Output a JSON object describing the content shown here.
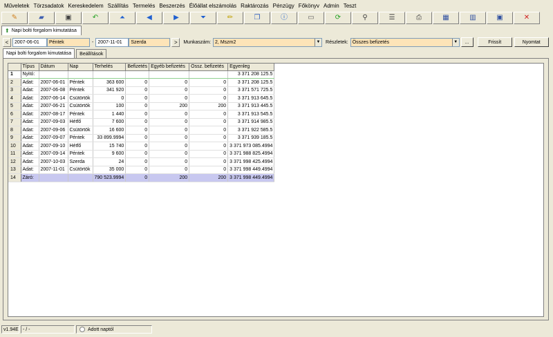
{
  "menu": [
    "Műveletek",
    "Törzsadatok",
    "Kereskedelem",
    "Szállítás",
    "Termelés",
    "Beszerzés",
    "Élőállat elszámolás",
    "Raktározás",
    "Pénzügy",
    "Főkönyv",
    "Admin",
    "Teszt"
  ],
  "toolbar": [
    {
      "name": "new-icon",
      "glyph": "✎",
      "color": "#d08020"
    },
    {
      "name": "open-folder-icon",
      "glyph": "▰",
      "color": "#4060b0"
    },
    {
      "name": "save-icon",
      "glyph": "▣",
      "color": "#404040"
    },
    {
      "name": "undo-icon",
      "glyph": "↶",
      "color": "#20a020"
    },
    {
      "name": "first-record-icon",
      "glyph": "⏶",
      "color": "#2060d0"
    },
    {
      "name": "previous-record-icon",
      "glyph": "◀",
      "color": "#2060d0"
    },
    {
      "name": "next-record-icon",
      "glyph": "▶",
      "color": "#2060d0"
    },
    {
      "name": "last-record-icon",
      "glyph": "⏷",
      "color": "#2060d0"
    },
    {
      "name": "edit-icon",
      "glyph": "✏",
      "color": "#c0a000"
    },
    {
      "name": "copy-icon",
      "glyph": "❐",
      "color": "#3060c0"
    },
    {
      "name": "info-icon",
      "glyph": "ⓘ",
      "color": "#2060d0"
    },
    {
      "name": "window-icon",
      "glyph": "▭",
      "color": "#606060"
    },
    {
      "name": "refresh-icon",
      "glyph": "⟳",
      "color": "#20a020"
    },
    {
      "name": "search-icon",
      "glyph": "⚲",
      "color": "#404040"
    },
    {
      "name": "list-icon",
      "glyph": "☰",
      "color": "#404040"
    },
    {
      "name": "print-icon",
      "glyph": "⎙",
      "color": "#404040"
    },
    {
      "name": "grid-icon",
      "glyph": "▦",
      "color": "#3050a0"
    },
    {
      "name": "table-icon",
      "glyph": "▥",
      "color": "#3050a0"
    },
    {
      "name": "tiles-icon",
      "glyph": "▣",
      "color": "#3050a0"
    },
    {
      "name": "close-icon",
      "glyph": "✕",
      "color": "#d02020"
    }
  ],
  "doc_tab": {
    "label": "Napi bolti forgalom kimutatása"
  },
  "filter": {
    "prev": "<",
    "date_from": "2007-06-01",
    "day_from": "Péntek",
    "date_to": "2007-11-01",
    "day_to": "Szerda",
    "next": ">",
    "munkaszam_label": "Munkaszám:",
    "munkaszam_value": "2, Mszm2",
    "reszletek_label": "Részletek:",
    "reszletek_value": "Összes befizetés",
    "ellipsis": "...",
    "frissit": "Frissít",
    "nyomtat": "Nyomtat"
  },
  "subtabs": [
    "Napi bolti forgalom kimutatása",
    "Beállítások"
  ],
  "table": {
    "headers": [
      "Típus",
      "Dátum",
      "Nap",
      "Terhelés",
      "Befizetés",
      "Egyéb befizetés",
      "Össz. befizetés",
      "Egyenleg"
    ],
    "rows": [
      [
        "1",
        "Nyitó:",
        "",
        "",
        "",
        "",
        "",
        "",
        "3 371 208 125.5"
      ],
      [
        "2",
        "Adat:",
        "2007-06-01",
        "Péntek",
        "363 600",
        "0",
        "0",
        "0",
        "3 371 208 125.5"
      ],
      [
        "3",
        "Adat:",
        "2007-06-08",
        "Péntek",
        "341 920",
        "0",
        "0",
        "0",
        "3 371 571 725.5"
      ],
      [
        "4",
        "Adat:",
        "2007-06-14",
        "Csütörtök",
        "0",
        "0",
        "0",
        "0",
        "3 371 913 645.5"
      ],
      [
        "5",
        "Adat:",
        "2007-06-21",
        "Csütörtök",
        "100",
        "0",
        "200",
        "200",
        "3 371 913 445.5"
      ],
      [
        "6",
        "Adat:",
        "2007-08-17",
        "Péntek",
        "1 440",
        "0",
        "0",
        "0",
        "3 371 913 545.5"
      ],
      [
        "7",
        "Adat:",
        "2007-09-03",
        "Hétfő",
        "7 600",
        "0",
        "0",
        "0",
        "3 371 914 985.5"
      ],
      [
        "8",
        "Adat:",
        "2007-09-06",
        "Csütörtök",
        "16 600",
        "0",
        "0",
        "0",
        "3 371 922 585.5"
      ],
      [
        "9",
        "Adat:",
        "2007-09-07",
        "Péntek",
        "33 899.9994",
        "0",
        "0",
        "0",
        "3 371 939 185.5"
      ],
      [
        "10",
        "Adat:",
        "2007-09-10",
        "Hétfő",
        "15 740",
        "0",
        "0",
        "0",
        "3 371 973 085.4994"
      ],
      [
        "11",
        "Adat:",
        "2007-09-14",
        "Péntek",
        "9 600",
        "0",
        "0",
        "0",
        "3 371 988 825.4994"
      ],
      [
        "12",
        "Adat:",
        "2007-10-03",
        "Szerda",
        "24",
        "0",
        "0",
        "0",
        "3 371 998 425.4994"
      ],
      [
        "13",
        "Adat:",
        "2007-11-01",
        "Csütörtök",
        "35 000",
        "0",
        "0",
        "0",
        "3 371 998 449.4994"
      ],
      [
        "14",
        "Záró:",
        "",
        "",
        "790 523.9994",
        "0",
        "200",
        "200",
        "3 371 998 449.4994"
      ]
    ]
  },
  "status": {
    "version": "v1.94E",
    "sep": "- / -",
    "radio_label": "Adott naptól"
  }
}
